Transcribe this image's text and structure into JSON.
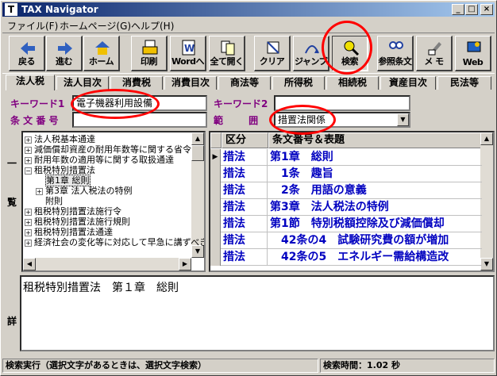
{
  "window": {
    "title": "TAX Navigator",
    "min": "_",
    "max": "□",
    "close": "×"
  },
  "menu": [
    "ファイル(F)",
    "ホームページ(G)",
    "ヘルプ(H)"
  ],
  "toolbar": [
    {
      "label": "戻る",
      "icon": "back-icon"
    },
    {
      "label": "進む",
      "icon": "forward-icon"
    },
    {
      "label": "ホーム",
      "icon": "home-icon"
    },
    {
      "label": "印刷",
      "icon": "print-icon"
    },
    {
      "label": "Wordへ",
      "icon": "word-icon"
    },
    {
      "label": "全て開く",
      "icon": "expand-all-icon"
    },
    {
      "label": "クリア",
      "icon": "clear-icon"
    },
    {
      "label": "ジャンプ",
      "icon": "jump-icon"
    },
    {
      "label": "検索",
      "icon": "search-icon"
    },
    {
      "label": "参照条文",
      "icon": "reference-icon"
    },
    {
      "label": "メ モ",
      "icon": "memo-icon"
    },
    {
      "label": "Web",
      "icon": "web-icon"
    }
  ],
  "tabs": [
    "法人税",
    "法人目次",
    "消費税",
    "消費目次",
    "商法等",
    "所得税",
    "相続税",
    "資産目次",
    "民法等"
  ],
  "search": {
    "keyword1_label": "キーワード1",
    "keyword1_value": "電子機器利用設備",
    "keyword2_label": "キーワード2",
    "keyword2_value": "",
    "article_label": "条 文 番 号",
    "article_value": "",
    "range_label": "範 囲",
    "range_value": "措置法関係"
  },
  "side": {
    "list_label_1": "一",
    "list_label_2": "覧",
    "detail_label": "詳"
  },
  "tree": [
    {
      "indent": 0,
      "exp": "+",
      "text": "法人税基本通達"
    },
    {
      "indent": 0,
      "exp": "+",
      "text": "減価償却資産の耐用年数等に関する省令"
    },
    {
      "indent": 0,
      "exp": "+",
      "text": "耐用年数の適用等に関する取扱通達"
    },
    {
      "indent": 0,
      "exp": "−",
      "text": "租税特別措置法"
    },
    {
      "indent": 1,
      "exp": "",
      "text": "第1章 総則",
      "selected": true
    },
    {
      "indent": 1,
      "exp": "+",
      "text": "第3章 法人税法の特例"
    },
    {
      "indent": 1,
      "exp": "",
      "text": "附則"
    },
    {
      "indent": 0,
      "exp": "+",
      "text": "租税特別措置法施行令"
    },
    {
      "indent": 0,
      "exp": "+",
      "text": "租税特別措置法施行規則"
    },
    {
      "indent": 0,
      "exp": "+",
      "text": "租税特別措置法通達"
    },
    {
      "indent": 0,
      "exp": "+",
      "text": "経済社会の変化等に対応して早急に講ずべき"
    }
  ],
  "grid": {
    "headers": [
      "区分",
      "条文番号＆表題"
    ],
    "rows": [
      {
        "kubun": "措法",
        "title": "第1章　総則"
      },
      {
        "kubun": "措法",
        "title": "　1条　趣旨"
      },
      {
        "kubun": "措法",
        "title": "　2条　用語の意義"
      },
      {
        "kubun": "措法",
        "title": "第3章　法人税法の特例"
      },
      {
        "kubun": "措法",
        "title": "第1節　特別税額控除及び減価償却"
      },
      {
        "kubun": "措法",
        "title": "　42条の4　試験研究費の額が増加"
      },
      {
        "kubun": "措法",
        "title": "　42条の5　エネルギー需給構造改"
      }
    ]
  },
  "detail": {
    "text": "租税特別措置法　第１章　総則"
  },
  "status": {
    "left": "検索実行（選択文字があるときは、選択文字検索）",
    "right": "検索時間：1.02 秒"
  }
}
